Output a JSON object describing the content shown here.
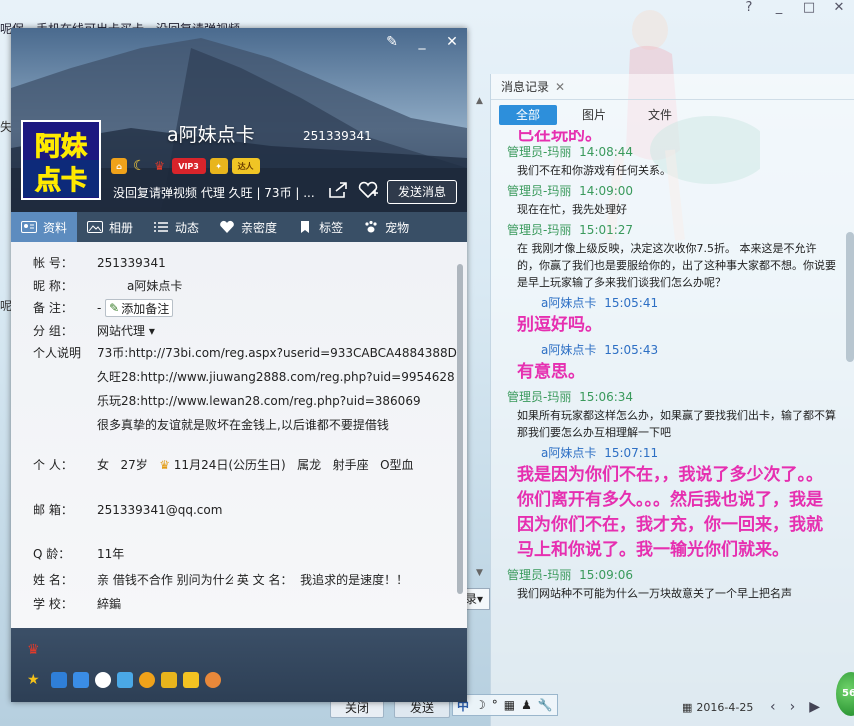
{
  "background": {
    "top_text": "呢保，手机在线可出卡买卡，没回复请弹视频",
    "left_stub": "失",
    "left_stub2": "呢",
    "select_stub": "录",
    "window_ctrls": [
      "?",
      "_",
      "□",
      "✕"
    ],
    "bottom_buttons": [
      "关闭",
      "发送"
    ],
    "status_items": [
      "中",
      "☽",
      "°",
      "▦",
      "♟",
      "🔧"
    ],
    "date": "2016-4-25",
    "green_badge": "56",
    "nav": [
      "‹",
      "›",
      "▶"
    ]
  },
  "messages_panel": {
    "tab_label": "消息记录",
    "filters": [
      "全部",
      "图片",
      "文件"
    ],
    "active_filter": "全部",
    "top_partial": "已在玩的。",
    "items": [
      {
        "sender": "管理员-玛丽",
        "time": "14:08:44",
        "self": false,
        "style": "normal",
        "text": "我们不在和你游戏有任何关系。"
      },
      {
        "sender": "管理员-玛丽",
        "time": "14:09:00",
        "self": false,
        "style": "normal",
        "text": "现在在忙，我先处理好"
      },
      {
        "sender": "管理员-玛丽",
        "time": "15:01:27",
        "self": false,
        "style": "normal",
        "text": "在  我刚才像上级反映，决定这次收你7.5折。 本来这是不允许的，你赢了我们也是要服给你的，出了这种事大家都不想。你说要是早上玩家输了多来我们谈我们怎么办呢？"
      },
      {
        "sender": "a阿妹点卡",
        "time": "15:05:41",
        "self": true,
        "style": "big",
        "text": "别逗好吗。"
      },
      {
        "sender": "a阿妹点卡",
        "time": "15:05:43",
        "self": true,
        "style": "big",
        "text": "有意思。"
      },
      {
        "sender": "管理员-玛丽",
        "time": "15:06:34",
        "self": false,
        "style": "normal",
        "text": "如果所有玩家都这样怎么办，如果赢了要找我们出卡，输了都不算那我们要怎么办互相理解一下吧"
      },
      {
        "sender": "a阿妹点卡",
        "time": "15:07:11",
        "self": true,
        "style": "big",
        "text": "我是因为你们不在，，我说了多少次了。。你们离开有多久。。。然后我也说了，我是因为你们不在，我才充，你一回来，我就马上和你说了。我一输光你们就来。"
      },
      {
        "sender": "管理员-玛丽",
        "time": "15:09:06",
        "self": false,
        "style": "normal",
        "text": "我们网站种不可能为什么一万块故意关了一个早上把名声"
      }
    ]
  },
  "profile": {
    "window_ctrls": [
      "✎",
      "_",
      "✕"
    ],
    "avatar_lines": [
      "阿妹",
      "点卡"
    ],
    "nickname": "a阿妹点卡",
    "qq": "251339341",
    "badges": [
      "VIP3",
      "达人"
    ],
    "signature": "没回复请弹视频 代理 久旺 | 73币 | ...",
    "send_button": "发送消息",
    "tabs": [
      {
        "label": "资料",
        "icon": "id-card-icon"
      },
      {
        "label": "相册",
        "icon": "photo-icon"
      },
      {
        "label": "动态",
        "icon": "list-icon"
      },
      {
        "label": "亲密度",
        "icon": "heart-icon"
      },
      {
        "label": "标签",
        "icon": "bookmark-icon"
      },
      {
        "label": "宠物",
        "icon": "paw-icon"
      }
    ],
    "fields": {
      "account_label": "帐    号：",
      "account": "251339341",
      "nick_label": "昵    称：",
      "nick": "a阿妹点卡",
      "remark_label": "备    注：",
      "remark_value": "-",
      "add_remark": "添加备注",
      "group_label": "分    组：",
      "group": "网站代理",
      "desc_label": "个人说明",
      "desc_lines": [
        "73币:http://73bi.com/reg.aspx?userid=933CABCA4884388D",
        "久旺28:http://www.jiuwang2888.com/reg.php?uid=9954628",
        "乐玩28:http://www.lewan28.com/reg.php?uid=386069",
        "很多真挚的友谊就是败坏在金钱上,以后谁都不要提借钱"
      ],
      "person_label": "个    人：",
      "gender": "女",
      "age": "27岁",
      "birthday": "11月24日(公历生日)",
      "zodiac": "属龙",
      "constellation": "射手座",
      "blood": "O型血",
      "email_label": "邮    箱：",
      "email": "251339341@qq.com",
      "qage_label": "Q    龄：",
      "qage": "11年",
      "name_label": "姓    名：",
      "name": "亲 借钱不合作 别问为什么",
      "en_label": "英 文 名：",
      "en_name": "我追求的是速度！！",
      "school_label": "学    校：",
      "school": "綷鍽"
    }
  },
  "colors": {
    "accent": "#2d8fdb",
    "time_green": "#3a9a5c",
    "self_blue": "#2d6fc4",
    "big_magenta": "#e62fb0",
    "tabbar": "#394f66",
    "tab_active": "#5d8cbf"
  }
}
